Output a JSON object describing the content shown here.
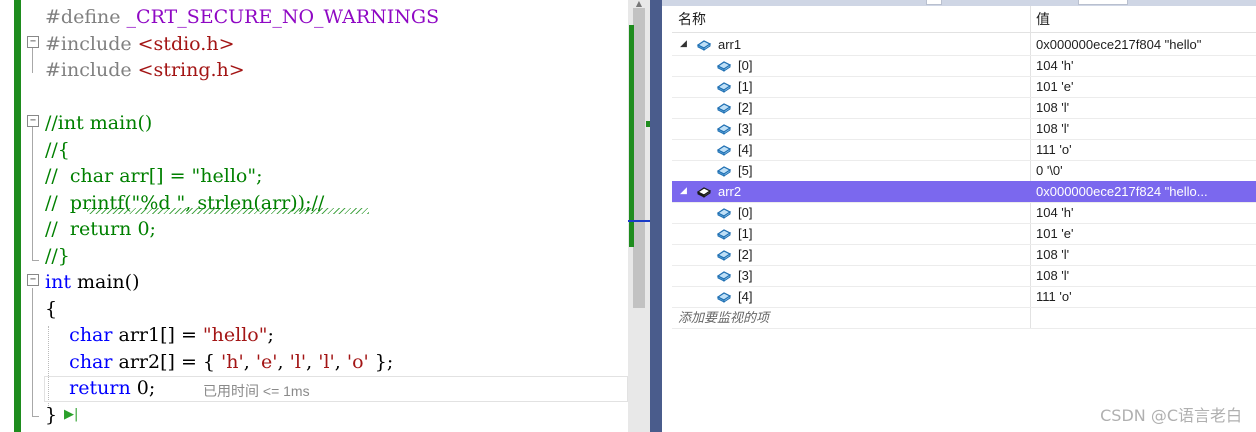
{
  "editor": {
    "lines": [
      {
        "segments": [
          {
            "t": "#define ",
            "c": "pp"
          },
          {
            "t": "_CRT_SECURE_NO_WARNINGS",
            "c": "mac"
          }
        ]
      },
      {
        "segments": [
          {
            "t": "#include ",
            "c": "pp"
          },
          {
            "t": "<stdio.h>",
            "c": "str"
          }
        ]
      },
      {
        "segments": [
          {
            "t": "#include ",
            "c": "pp"
          },
          {
            "t": "<string.h>",
            "c": "str"
          }
        ]
      },
      {
        "segments": []
      },
      {
        "segments": [
          {
            "t": "//int main()",
            "c": "cm"
          }
        ]
      },
      {
        "segments": [
          {
            "t": "//{",
            "c": "cm"
          }
        ]
      },
      {
        "segments": [
          {
            "t": "//  char arr[] = \"hello\";",
            "c": "cm"
          }
        ]
      },
      {
        "segments": [
          {
            "t": "//  printf(\"%d \", strlen(arr));//",
            "c": "cm"
          }
        ]
      },
      {
        "segments": [
          {
            "t": "//  return 0;",
            "c": "cm"
          }
        ]
      },
      {
        "segments": [
          {
            "t": "//}",
            "c": "cm"
          }
        ]
      },
      {
        "segments": [
          {
            "t": "int",
            "c": "kw"
          },
          {
            "t": " main()",
            "c": ""
          }
        ]
      },
      {
        "segments": [
          {
            "t": "{",
            "c": ""
          }
        ]
      },
      {
        "segments": [
          {
            "t": "    ",
            "c": ""
          },
          {
            "t": "char",
            "c": "kw"
          },
          {
            "t": " arr1[] = ",
            "c": ""
          },
          {
            "t": "\"hello\"",
            "c": "str"
          },
          {
            "t": ";",
            "c": ""
          }
        ]
      },
      {
        "segments": [
          {
            "t": "    ",
            "c": ""
          },
          {
            "t": "char",
            "c": "kw"
          },
          {
            "t": " arr2[] = { ",
            "c": ""
          },
          {
            "t": "'h'",
            "c": "str"
          },
          {
            "t": ", ",
            "c": ""
          },
          {
            "t": "'e'",
            "c": "str"
          },
          {
            "t": ", ",
            "c": ""
          },
          {
            "t": "'l'",
            "c": "str"
          },
          {
            "t": ", ",
            "c": ""
          },
          {
            "t": "'l'",
            "c": "str"
          },
          {
            "t": ", ",
            "c": ""
          },
          {
            "t": "'o'",
            "c": "str"
          },
          {
            "t": " };",
            "c": ""
          }
        ]
      },
      {
        "segments": [
          {
            "t": "    ",
            "c": ""
          },
          {
            "t": "return",
            "c": "kw"
          },
          {
            "t": " 0;",
            "c": ""
          }
        ]
      },
      {
        "segments": [
          {
            "t": "}",
            "c": ""
          }
        ]
      }
    ],
    "elapsed_hint": "已用时间 <= 1ms",
    "run_glyph": "▶|"
  },
  "watch": {
    "header": {
      "name": "名称",
      "value": "值"
    },
    "rows": [
      {
        "name": "arr1",
        "value": "0x000000ece217f804 \"hello\"",
        "level": 0,
        "expanded": true,
        "selected": false
      },
      {
        "name": "[0]",
        "value": "104 'h'",
        "level": 1
      },
      {
        "name": "[1]",
        "value": "101 'e'",
        "level": 1
      },
      {
        "name": "[2]",
        "value": "108 'l'",
        "level": 1
      },
      {
        "name": "[3]",
        "value": "108 'l'",
        "level": 1
      },
      {
        "name": "[4]",
        "value": "111 'o'",
        "level": 1
      },
      {
        "name": "[5]",
        "value": "0 '\\0'",
        "level": 1
      },
      {
        "name": "arr2",
        "value": "0x000000ece217f824 \"hello...",
        "level": 0,
        "expanded": true,
        "selected": true
      },
      {
        "name": "[0]",
        "value": "104 'h'",
        "level": 1
      },
      {
        "name": "[1]",
        "value": "101 'e'",
        "level": 1
      },
      {
        "name": "[2]",
        "value": "108 'l'",
        "level": 1
      },
      {
        "name": "[3]",
        "value": "108 'l'",
        "level": 1
      },
      {
        "name": "[4]",
        "value": "111 'o'",
        "level": 1
      }
    ],
    "add_item": "添加要监视的项"
  },
  "watermark": "CSDN @C语言老白",
  "colors": {
    "keyword": "#0000ff",
    "string": "#a31515",
    "preprocessor": "#808080",
    "macro": "#8f08c4",
    "comment": "#008000",
    "selection": "#7b68ee",
    "change_bar": "#1e8c1e"
  }
}
